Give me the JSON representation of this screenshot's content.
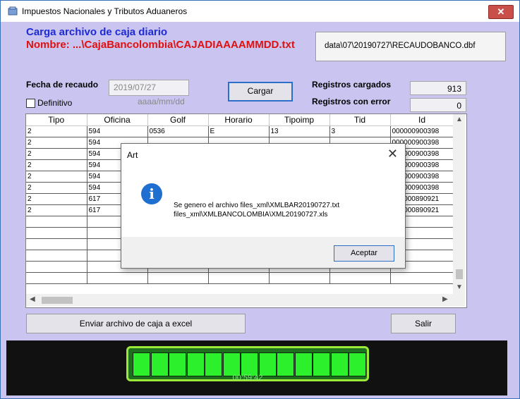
{
  "window": {
    "title": "Impuestos Nacionales y Tributos Aduaneros"
  },
  "header": {
    "line1": "Carga archivo de caja diario",
    "line2": "Nombre: ...\\CajaBancolombia\\CAJADIAAAAMMDD.txt",
    "file_path": "data\\07\\20190727\\RECAUDOBANCO.dbf"
  },
  "form": {
    "fecha_label": "Fecha de recaudo",
    "fecha_value": "2019/07/27",
    "definitivo_label": "Definitivo",
    "date_hint": "aaaa/mm/dd",
    "cargar_label": "Cargar",
    "registros_cargados_label": "Registros cargados",
    "registros_cargados_value": "913",
    "registros_error_label": "Registros con error",
    "registros_error_value": "0"
  },
  "table": {
    "columns": [
      "Tipo",
      "Oficina",
      "Golf",
      "Horario",
      "Tipoimp",
      "Tid",
      "Id"
    ],
    "rows": [
      [
        "2",
        "594",
        "0536",
        "E",
        "13",
        "3",
        "000000900398"
      ],
      [
        "2",
        "594",
        "",
        "",
        "",
        "",
        "000000900398"
      ],
      [
        "2",
        "594",
        "",
        "",
        "",
        "",
        "000000900398"
      ],
      [
        "2",
        "594",
        "",
        "",
        "",
        "",
        "000000900398"
      ],
      [
        "2",
        "594",
        "",
        "",
        "",
        "",
        "000000900398"
      ],
      [
        "2",
        "594",
        "",
        "",
        "",
        "",
        "000000900398"
      ],
      [
        "2",
        "617",
        "",
        "",
        "",
        "",
        "000000890921"
      ],
      [
        "2",
        "617",
        "",
        "",
        "",
        "",
        "000000890921"
      ]
    ]
  },
  "buttons": {
    "excel_label": "Enviar archivo de caja a excel",
    "salir_label": "Salir"
  },
  "timer": {
    "value": "00:59:42",
    "cells": 13
  },
  "dialog": {
    "title": "Art",
    "message_line1": "Se genero el archivo files_xml\\XMLBAR20190727.txt",
    "message_line2": "files_xml\\XMLBANCOLOMBIA\\XML20190727.xls",
    "ok_label": "Aceptar"
  }
}
